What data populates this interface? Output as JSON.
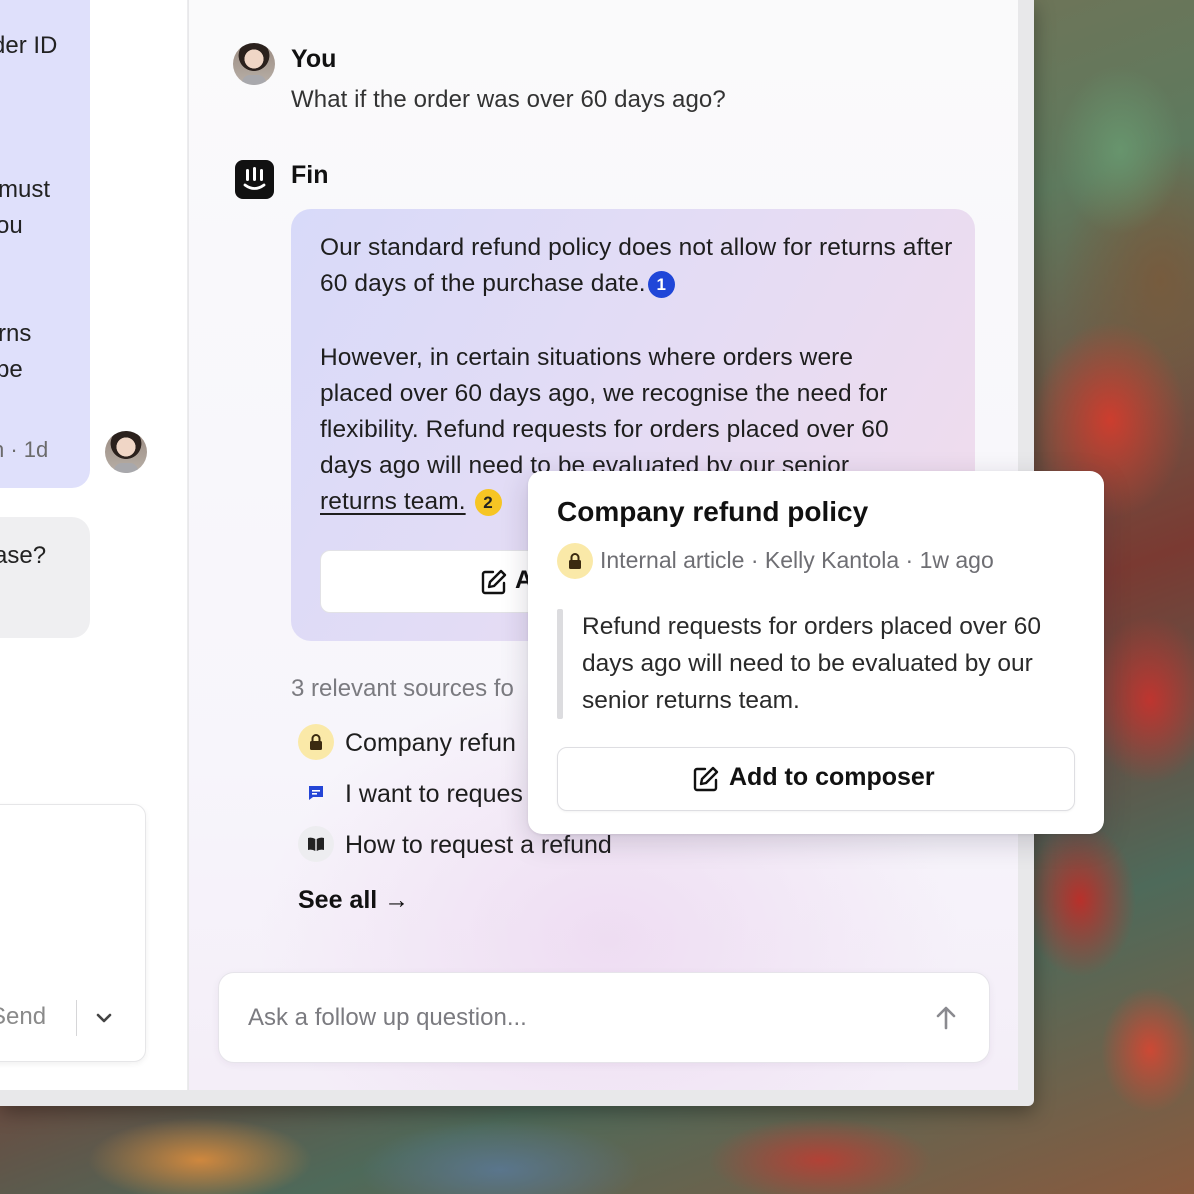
{
  "left_conversation": {
    "fragments": [
      "der ID",
      "must",
      "ou",
      "rns",
      "be"
    ],
    "meta": "n ·  1d",
    "grey_bubble_text": "ase?",
    "composer": {
      "send_label": "Send"
    }
  },
  "copilot": {
    "user_message": {
      "author": "You",
      "text": "What if the order was over 60 days ago?"
    },
    "fin_message": {
      "author": "Fin",
      "paragraph1": "Our standard refund policy does not allow for returns after 60 days of the purchase date.",
      "citation1": "1",
      "paragraph2_lines": [
        "However, in certain situations where orders were",
        "placed over 60 days ago, we recognise the need for",
        "flexibility. Refund requests for orders placed over 60",
        "days ago will need to be evaluated by our senior"
      ],
      "paragraph2_end": "returns team.",
      "citation2": "2",
      "add_button_label": "A"
    },
    "sources": {
      "heading": "3 relevant sources fo",
      "items": [
        {
          "icon": "lock-icon",
          "label": "Company refun"
        },
        {
          "icon": "chat-icon",
          "label": "I want to reques"
        },
        {
          "icon": "book-icon",
          "label": "How to request a refund"
        }
      ],
      "see_all": "See all →"
    },
    "followup": {
      "placeholder": "Ask a follow up question..."
    }
  },
  "popover": {
    "title": "Company refund policy",
    "meta": "Internal article · Kelly Kantola · 1w ago",
    "quote": "Refund requests for orders placed over 60 days ago will need to be evaluated by our senior returns team.",
    "button_label": "Add to composer"
  },
  "colors": {
    "citation_blue": "#1f46d8",
    "citation_yellow": "#f6c524",
    "lock_badge": "#fae9a8",
    "bubble_gradient_start": "#d8daf9",
    "bubble_gradient_end": "#f1dcec"
  }
}
